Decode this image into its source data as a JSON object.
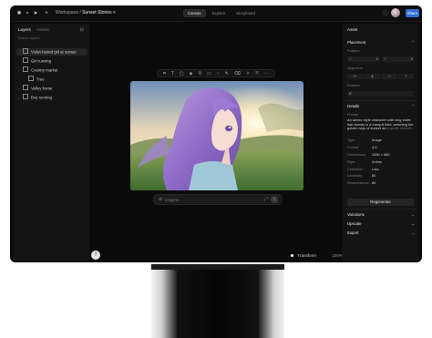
{
  "breadcrumb": {
    "workspace": "Workspace",
    "separator": "/",
    "project": "Sunset Stories"
  },
  "view_tabs": [
    {
      "label": "Canvas",
      "active": true
    },
    {
      "label": "Explore",
      "active": false
    },
    {
      "label": "Storyboard",
      "active": false
    }
  ],
  "share_label": "Share",
  "left_panel": {
    "tabs": [
      "Layers",
      "Assets"
    ],
    "search_placeholder": "Search layers",
    "layers": [
      {
        "label": "Violet-haired girl at sunset",
        "selected": true,
        "indent": 0,
        "chevron": "",
        "icon": "image-icon"
      },
      {
        "label": "Girl running",
        "selected": false,
        "indent": 0,
        "chevron": "",
        "icon": "image-icon"
      },
      {
        "label": "Country market",
        "selected": false,
        "indent": 0,
        "chevron": "›",
        "icon": "folder-icon"
      },
      {
        "label": "Tree",
        "selected": false,
        "indent": 1,
        "chevron": "",
        "icon": "image-icon"
      },
      {
        "label": "Valley home",
        "selected": false,
        "indent": 0,
        "chevron": "›",
        "icon": "folder-icon"
      },
      {
        "label": "Boy running",
        "selected": false,
        "indent": 0,
        "chevron": "›",
        "icon": "folder-icon"
      }
    ]
  },
  "toolbar_icons": [
    "crop-icon",
    "text-icon",
    "square-icon",
    "paint-icon",
    "wand-icon",
    "frame-icon",
    "comment-icon",
    "brush-icon",
    "eraser-icon",
    "star-icon",
    "expand-icon",
    "more-icon"
  ],
  "prompt_bar": {
    "placeholder": "Imagine..."
  },
  "bottom": {
    "transform_label": "Transform",
    "zoom": "100%"
  },
  "right_panel": {
    "title": "Asset",
    "placement": {
      "title": "Placement",
      "position_label": "Position",
      "x": "0",
      "y": "0",
      "alignment_label": "Alignment",
      "rotation_label": "Rotation",
      "rotation": "0°"
    },
    "details": {
      "title": "Details",
      "prompt_label": "Prompt",
      "prompt_text": "An anime-style character with long violet hair stands in a tranquil field, watching the golden rays of sunset as",
      "prompt_fade": "a gentle breeze...",
      "properties": [
        {
          "key": "Type",
          "value": "Image"
        },
        {
          "key": "Format",
          "value": "4:3"
        },
        {
          "key": "Dimensions",
          "value": "1280 × 960"
        },
        {
          "key": "Style",
          "value": "Anime"
        },
        {
          "key": "Character",
          "value": "Lola"
        },
        {
          "key": "Creativity",
          "value": "80"
        },
        {
          "key": "Resemblance",
          "value": "80"
        }
      ],
      "regenerate_label": "Regenerate"
    },
    "collapsed_sections": [
      "Variations",
      "Upscale",
      "Export"
    ]
  },
  "help_label": "?"
}
